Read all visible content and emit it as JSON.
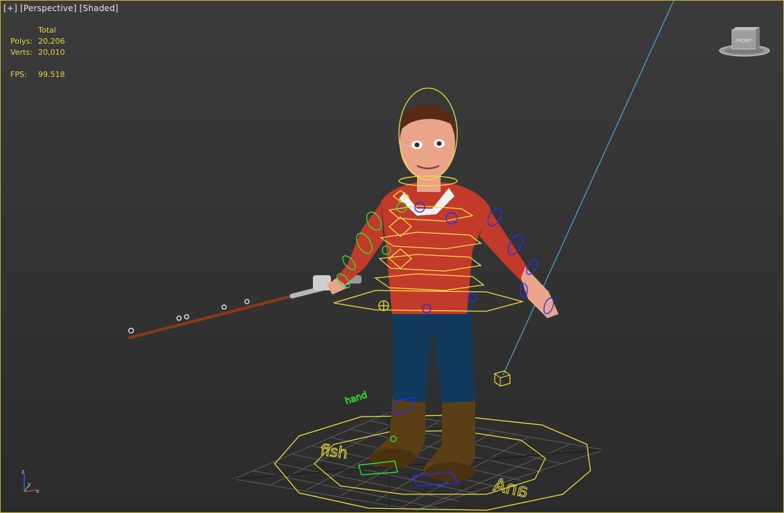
{
  "viewport": {
    "labels": [
      "[+]",
      "[Perspective]",
      "[Shaded]"
    ]
  },
  "stats": {
    "header": "Total",
    "polys_label": "Polys:",
    "polys_value": "20,206",
    "verts_label": "Verts:",
    "verts_value": "20,010",
    "fps_label": "FPS:",
    "fps_value": "99.518"
  },
  "viewcube": {
    "face_label": "FRONT"
  },
  "axis_tripod": {
    "z": "z",
    "y": "y",
    "x": "x"
  },
  "colors": {
    "viewport_border": "#c8b23a",
    "stats_text": "#e8d24a",
    "rig_yellow": "#f0e040",
    "rig_blue": "#2a2aff",
    "rig_green": "#30e030",
    "light_line": "#4aa8e8"
  }
}
